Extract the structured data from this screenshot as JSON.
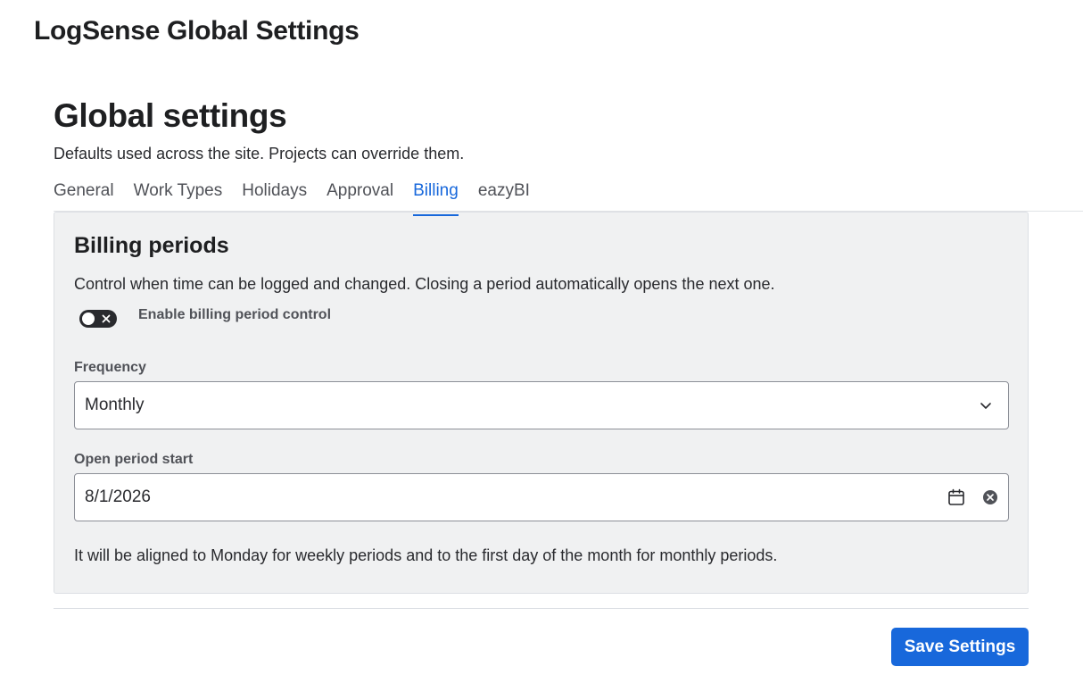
{
  "app": {
    "title": "LogSense Global Settings"
  },
  "page": {
    "title": "Global settings",
    "subtitle": "Defaults used across the site. Projects can override them."
  },
  "tabs": [
    {
      "label": "General",
      "active": false
    },
    {
      "label": "Work Types",
      "active": false
    },
    {
      "label": "Holidays",
      "active": false
    },
    {
      "label": "Approval",
      "active": false
    },
    {
      "label": "Billing",
      "active": true
    },
    {
      "label": "eazyBI",
      "active": false
    }
  ],
  "billing": {
    "title": "Billing periods",
    "description": "Control when time can be logged and changed. Closing a period automatically opens the next one.",
    "toggle": {
      "label": "Enable billing period control",
      "enabled": false,
      "icon": "close-icon"
    },
    "frequency": {
      "label": "Frequency",
      "value": "Monthly",
      "icon": "chevron-down-icon"
    },
    "open_period_start": {
      "label": "Open period start",
      "value": "8/1/2026",
      "icons": [
        "calendar-icon",
        "clear-icon"
      ]
    },
    "helper": "It will be aligned to Monday for weekly periods and to the first day of the month for monthly periods."
  },
  "footer": {
    "save_label": "Save Settings"
  },
  "colors": {
    "accent": "#1868db",
    "panel_bg": "#f0f1f2",
    "toggle_off": "#292a2e"
  }
}
